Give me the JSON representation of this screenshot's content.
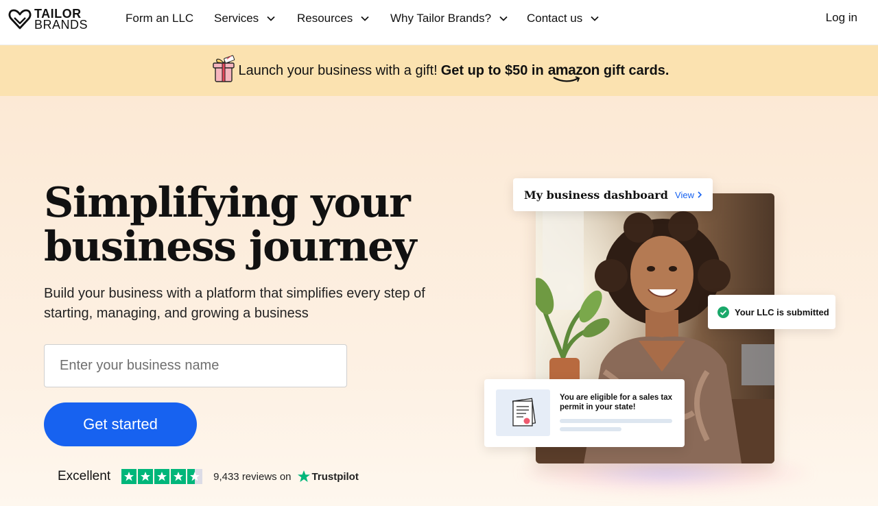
{
  "brand": {
    "line1": "TAILOR",
    "line2": "BRANDS"
  },
  "nav": {
    "items": [
      {
        "label": "Form an LLC",
        "has_dropdown": false
      },
      {
        "label": "Services",
        "has_dropdown": true
      },
      {
        "label": "Resources",
        "has_dropdown": true
      },
      {
        "label": "Why Tailor Brands?",
        "has_dropdown": true
      },
      {
        "label": "Contact us",
        "has_dropdown": true
      }
    ],
    "login": "Log in"
  },
  "promo": {
    "text": "Launch your business with a gift!",
    "bold": "Get up to $50 in",
    "brand": "amazon",
    "bold_end": "gift cards.",
    "icon": "gift-icon",
    "background": "#fbe2b0"
  },
  "hero": {
    "headline_line1": "Simplifying your",
    "headline_line2": "business journey",
    "subhead": "Build your business with a platform that simplifies every step of starting, managing, and growing a business",
    "input_placeholder": "Enter your business name",
    "cta_label": "Get started",
    "cta_color": "#1762f0"
  },
  "trustpilot": {
    "rating_label": "Excellent",
    "stars": 4.5,
    "reviews": "9,433 reviews on",
    "brand": "Trustpilot",
    "star_color": "#00b67a"
  },
  "dashboard": {
    "title": "My business dashboard",
    "view_label": "View",
    "llc_status": "Your LLC is submitted",
    "tax_notice": "You are eligible for a sales tax permit in your state!"
  }
}
